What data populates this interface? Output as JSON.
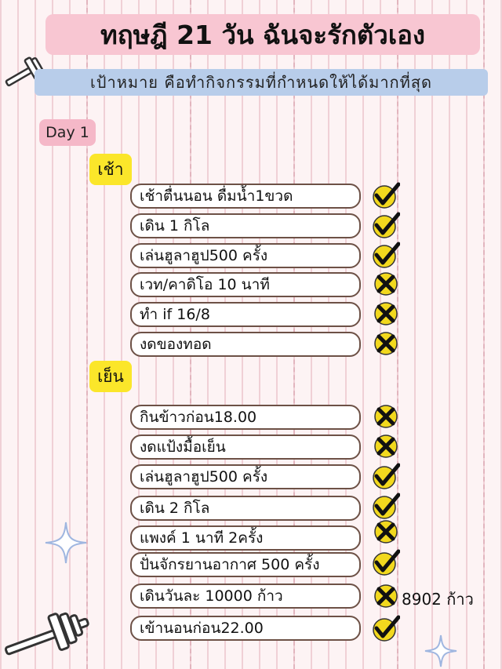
{
  "title": "ทฤษฎี 21 วัน ฉันจะรักตัวเอง",
  "goal": "เป้าหมาย คือทำกิจกรรมที่กำหนดให้ได้มากที่สุด",
  "day_label": "Day 1",
  "morning": {
    "label": "เช้า",
    "tasks": [
      {
        "text": "เช้าตื่นนอน ดื่มน้ำ1ขวด",
        "status": "done"
      },
      {
        "text": "เดิน  1 กิโล",
        "status": "done"
      },
      {
        "text": "เล่นฮูลาฮูป500 ครั้ง",
        "status": "done"
      },
      {
        "text": "เวท/คาดิโอ  10  นาที",
        "status": "not-done"
      },
      {
        "text": "ทำ if 16/8",
        "status": "not-done"
      },
      {
        "text": "งดของทอด",
        "status": "not-done"
      }
    ]
  },
  "evening": {
    "label": "เย็น",
    "tasks": [
      {
        "text": "กินข้าวก่อน18.00",
        "status": "not-done"
      },
      {
        "text": "งดแป้งมื้อเย็น",
        "status": "not-done"
      },
      {
        "text": "เล่นฮูลาฮูป500 ครั้ง",
        "status": "done"
      },
      {
        "text": "เดิน 2 กิโล",
        "status": "done"
      },
      {
        "text": "แพงค์ 1 นาที 2ครั้ง",
        "status": "not-done"
      },
      {
        "text": "ปั่นจักรยานอากาศ 500 ครั้ง",
        "status": "done"
      },
      {
        "text": "เดินวันละ 10000 ก้าว",
        "status": "not-done",
        "note": "8902 ก้าว"
      },
      {
        "text": "เข้านอนก่อน22.00",
        "status": "done"
      }
    ]
  },
  "colors": {
    "title_bg": "#f8c6d2",
    "goal_bg": "#b8cdea",
    "day_bg": "#f5b8c8",
    "section_bg": "#fbe62a",
    "mark_bg": "#f2d81e",
    "task_border": "#6d5146"
  },
  "icons": {
    "done": "check-icon",
    "not_done": "cross-icon",
    "decor": [
      "dumbbell-icon",
      "sparkle-icon"
    ]
  }
}
